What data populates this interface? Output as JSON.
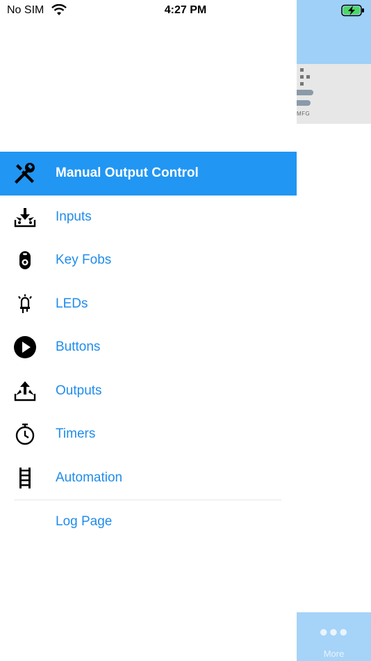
{
  "status_bar": {
    "carrier": "No SIM",
    "time": "4:27 PM"
  },
  "background_app": {
    "logo_text": "MFG",
    "tab_more_icon": "more-dots-icon",
    "tab_more_label": "More",
    "header_color": "#9fd0f7"
  },
  "menu": {
    "accent_color": "#2196f3",
    "label_color": "#1f8ceb",
    "items": [
      {
        "label": "Manual Output Control",
        "icon": "wrench-screwdriver-icon",
        "active": true
      },
      {
        "label": "Inputs",
        "icon": "inputs-tray-icon",
        "active": false
      },
      {
        "label": "Key Fobs",
        "icon": "key-fob-icon",
        "active": false
      },
      {
        "label": "LEDs",
        "icon": "led-icon",
        "active": false
      },
      {
        "label": "Buttons",
        "icon": "play-button-icon",
        "active": false
      },
      {
        "label": "Outputs",
        "icon": "outputs-tray-icon",
        "active": false
      },
      {
        "label": "Timers",
        "icon": "stopwatch-icon",
        "active": false
      },
      {
        "label": "Automation",
        "icon": "ladder-icon",
        "active": false
      }
    ],
    "log_page": "Log Page"
  }
}
